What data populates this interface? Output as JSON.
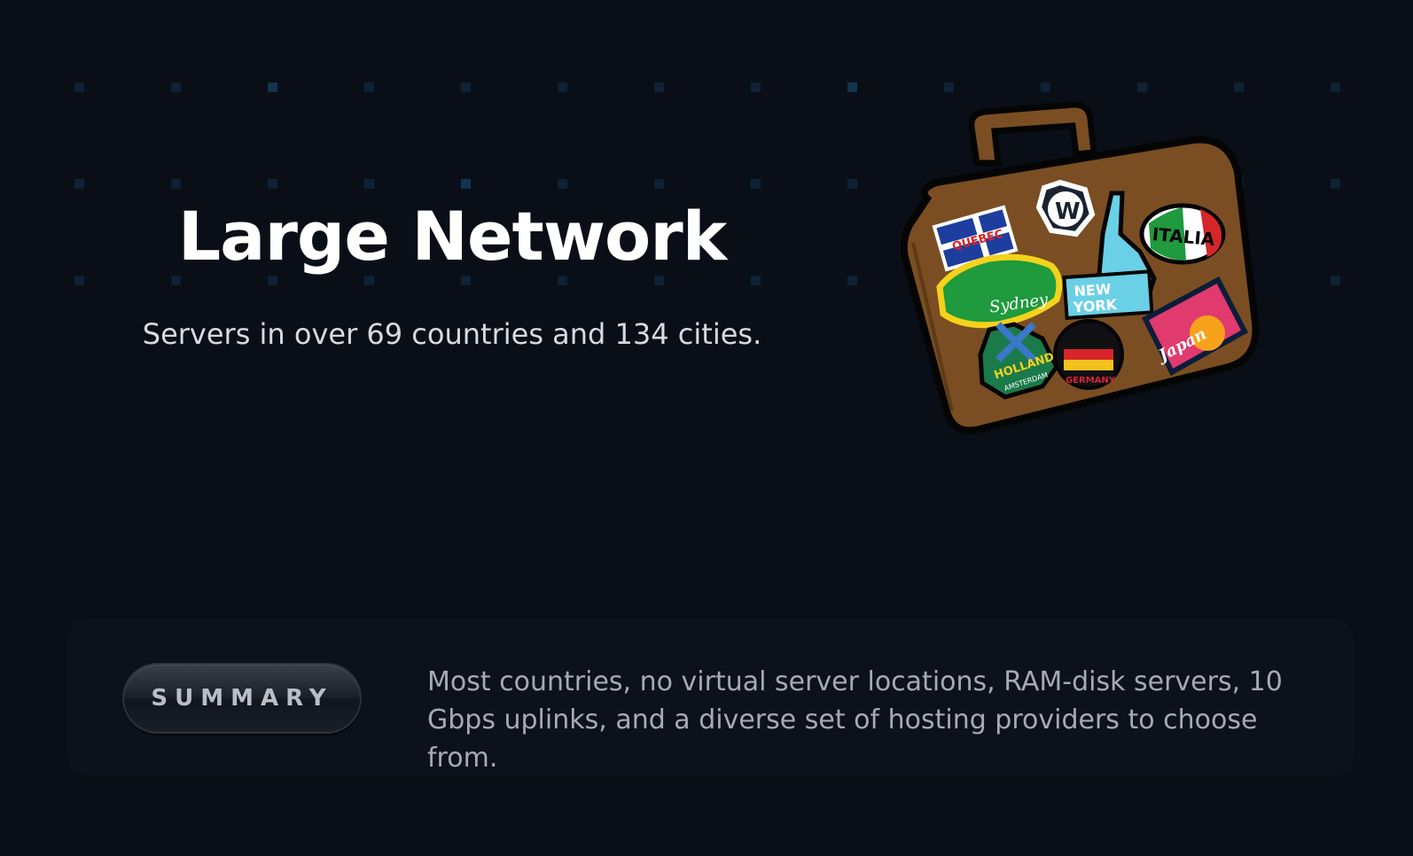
{
  "hero": {
    "title": "Large Network",
    "subtitle": "Servers in over 69 countries and 134 cities."
  },
  "illustration": {
    "name": "suitcase-with-travel-stickers",
    "stickers": [
      "QUEBEC",
      "W",
      "ITALIA",
      "Sydney",
      "NEW YORK",
      "HOLLAND",
      "AMSTERDAM",
      "GERMANY",
      "Japan"
    ]
  },
  "summary": {
    "button_label": "SUMMARY",
    "text": "Most countries, no virtual server locations, RAM-disk servers, 10 Gbps uplinks, and a diverse set of hosting providers to choose from."
  },
  "colors": {
    "background": "#0a0e17",
    "card": "#0c111b",
    "dot": "#0e2233",
    "dot_bright": "#12344d",
    "suitcase": "#7a4e22"
  }
}
